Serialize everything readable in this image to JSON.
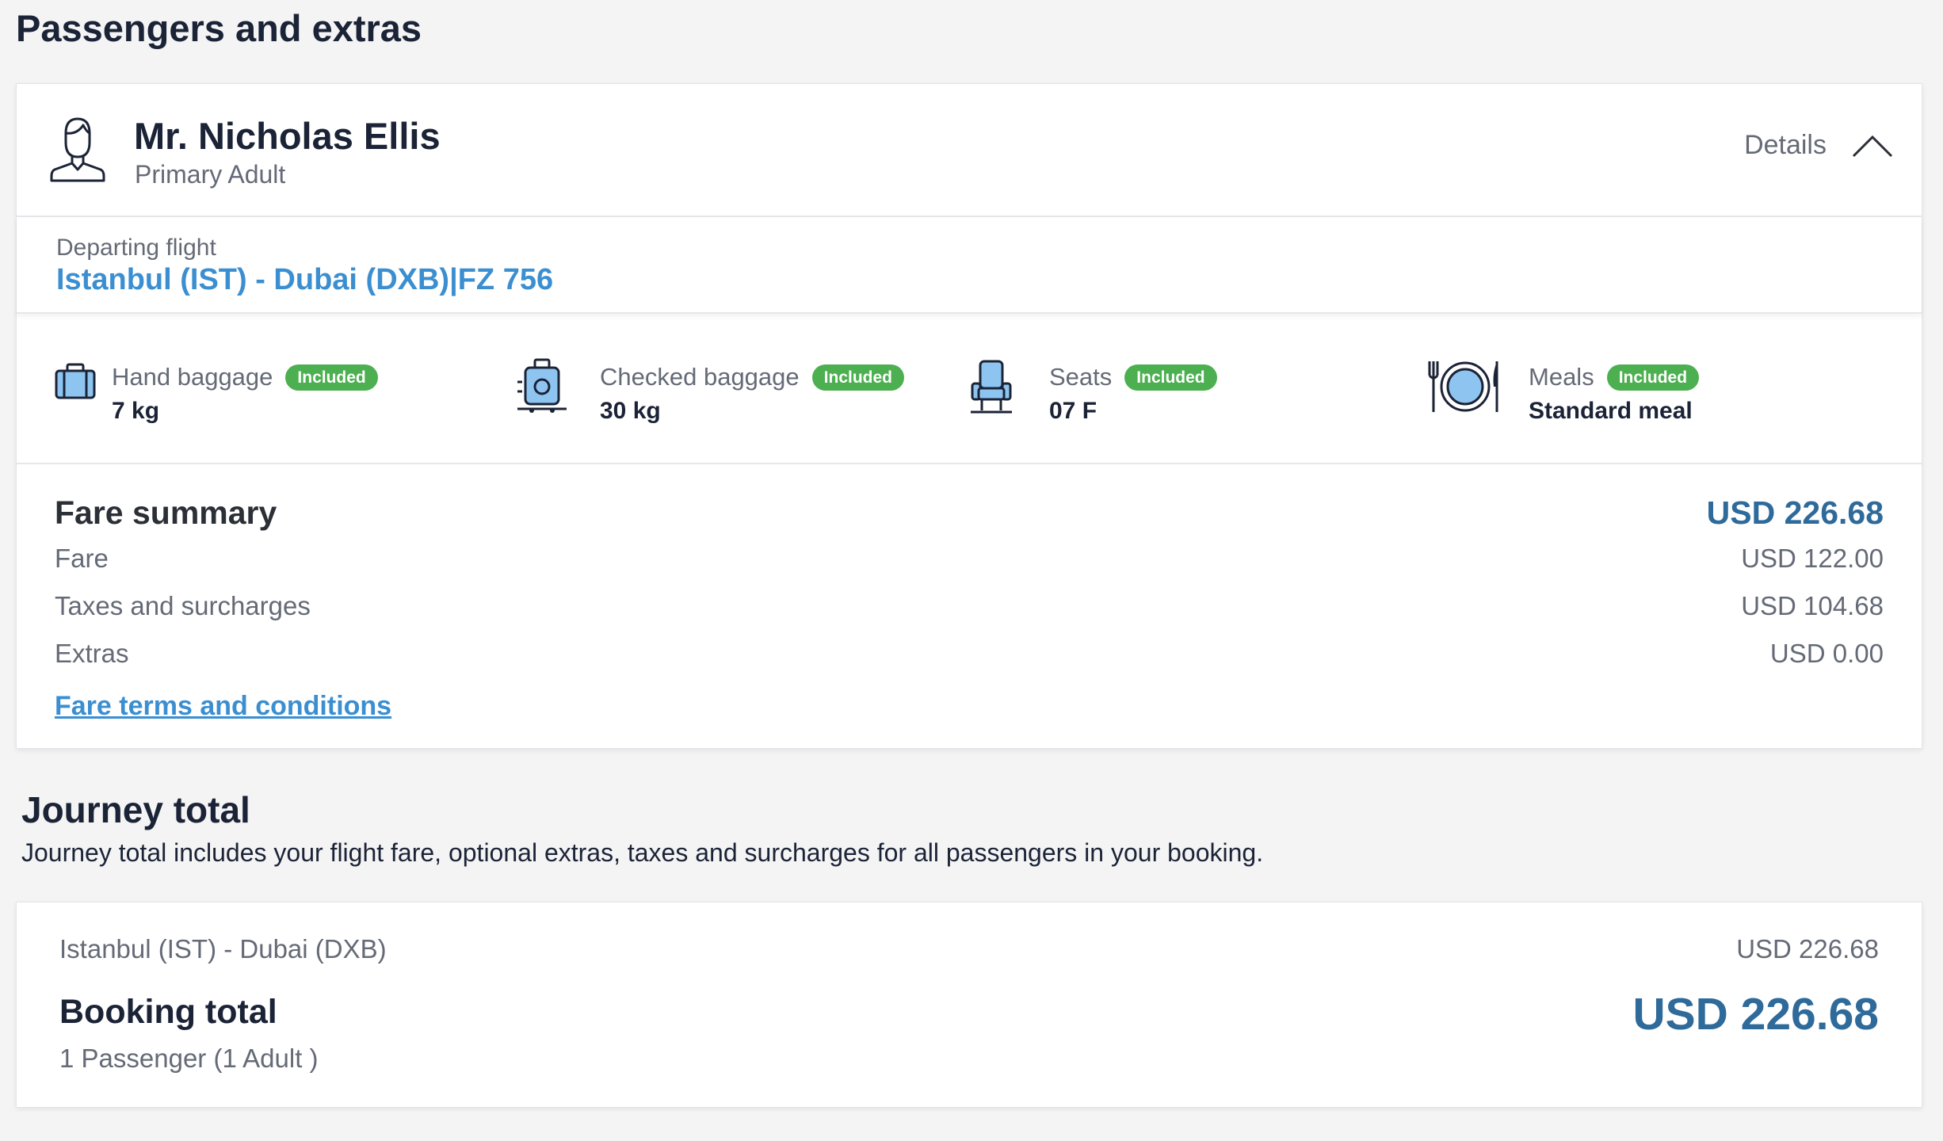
{
  "page": {
    "section_title": "Passengers and extras"
  },
  "passenger": {
    "name": "Mr. Nicholas Ellis",
    "type": "Primary Adult",
    "details_label": "Details",
    "avatar_icon": "person-outline-icon",
    "toggle_icon": "chevron-up-icon"
  },
  "flight": {
    "label": "Departing flight",
    "route": "Istanbul (IST) - Dubai (DXB)|FZ 756"
  },
  "extras": [
    {
      "label": "Hand baggage",
      "badge": "Included",
      "value": "7 kg",
      "icon": "hand-baggage-icon"
    },
    {
      "label": "Checked baggage",
      "badge": "Included",
      "value": "30 kg",
      "icon": "checked-baggage-icon"
    },
    {
      "label": "Seats",
      "badge": "Included",
      "value": "07 F",
      "icon": "seat-icon"
    },
    {
      "label": "Meals",
      "badge": "Included",
      "value": "Standard meal",
      "icon": "meal-icon"
    }
  ],
  "fare_summary": {
    "title": "Fare summary",
    "total": "USD 226.68",
    "rows": [
      {
        "label": "Fare",
        "amount": "USD 122.00"
      },
      {
        "label": "Taxes and surcharges",
        "amount": "USD 104.68"
      },
      {
        "label": "Extras",
        "amount": "USD 0.00"
      }
    ],
    "terms_link": "Fare terms and conditions"
  },
  "journey_total": {
    "title": "Journey total",
    "description": "Journey total includes your flight fare, optional extras, taxes and surcharges for all passengers in your booking.",
    "route": "Istanbul (IST) - Dubai (DXB)",
    "route_amount": "USD 226.68",
    "booking_total_label": "Booking total",
    "passengers": "1 Passenger (1 Adult )",
    "booking_total_amount": "USD 226.68"
  },
  "colors": {
    "accent_blue": "#3b8fd1",
    "total_blue": "#2e6a9a",
    "badge_green": "#4caf50",
    "icon_fill": "#8ec5f0"
  }
}
